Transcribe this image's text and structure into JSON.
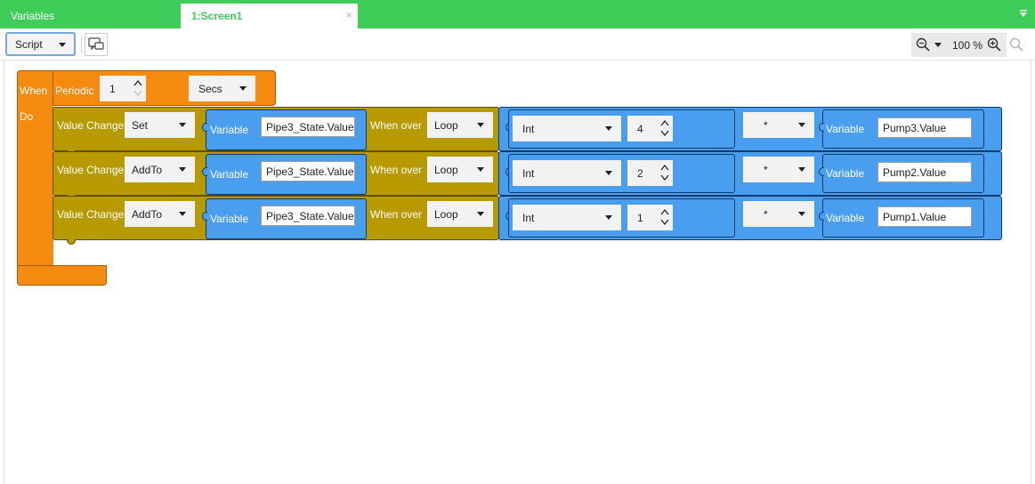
{
  "tabs": {
    "variables_label": "Variables",
    "screen_label": "1:Screen1",
    "close_glyph": "×"
  },
  "toolbar": {
    "script_dropdown": "Script",
    "comment_icon": "comment-icon",
    "zoom_value": "100 %"
  },
  "block": {
    "when_label": "When",
    "do_label": "Do",
    "periodic_label": "Periodic",
    "period_value": "1",
    "period_unit": "Secs",
    "colors": {
      "event": "#f48a0e",
      "action": "#b79a00",
      "value": "#4a9ef0",
      "tab_bar": "#3ecd59"
    },
    "rows": [
      {
        "action_label": "Value Change",
        "mode": "Set",
        "var_label": "Variable",
        "target": "Pipe3_State.Value",
        "when_over_label": "When over",
        "when_over": "Loop",
        "type": "Int",
        "number": "4",
        "operator": "*",
        "var2_label": "Variable",
        "source": "Pump3.Value"
      },
      {
        "action_label": "Value Change",
        "mode": "AddTo",
        "var_label": "Variable",
        "target": "Pipe3_State.Value",
        "when_over_label": "When over",
        "when_over": "Loop",
        "type": "Int",
        "number": "2",
        "operator": "*",
        "var2_label": "Variable",
        "source": "Pump2.Value"
      },
      {
        "action_label": "Value Change",
        "mode": "AddTo",
        "var_label": "Variable",
        "target": "Pipe3_State.Value",
        "when_over_label": "When over",
        "when_over": "Loop",
        "type": "Int",
        "number": "1",
        "operator": "*",
        "var2_label": "Variable",
        "source": "Pump1.Value"
      }
    ]
  }
}
